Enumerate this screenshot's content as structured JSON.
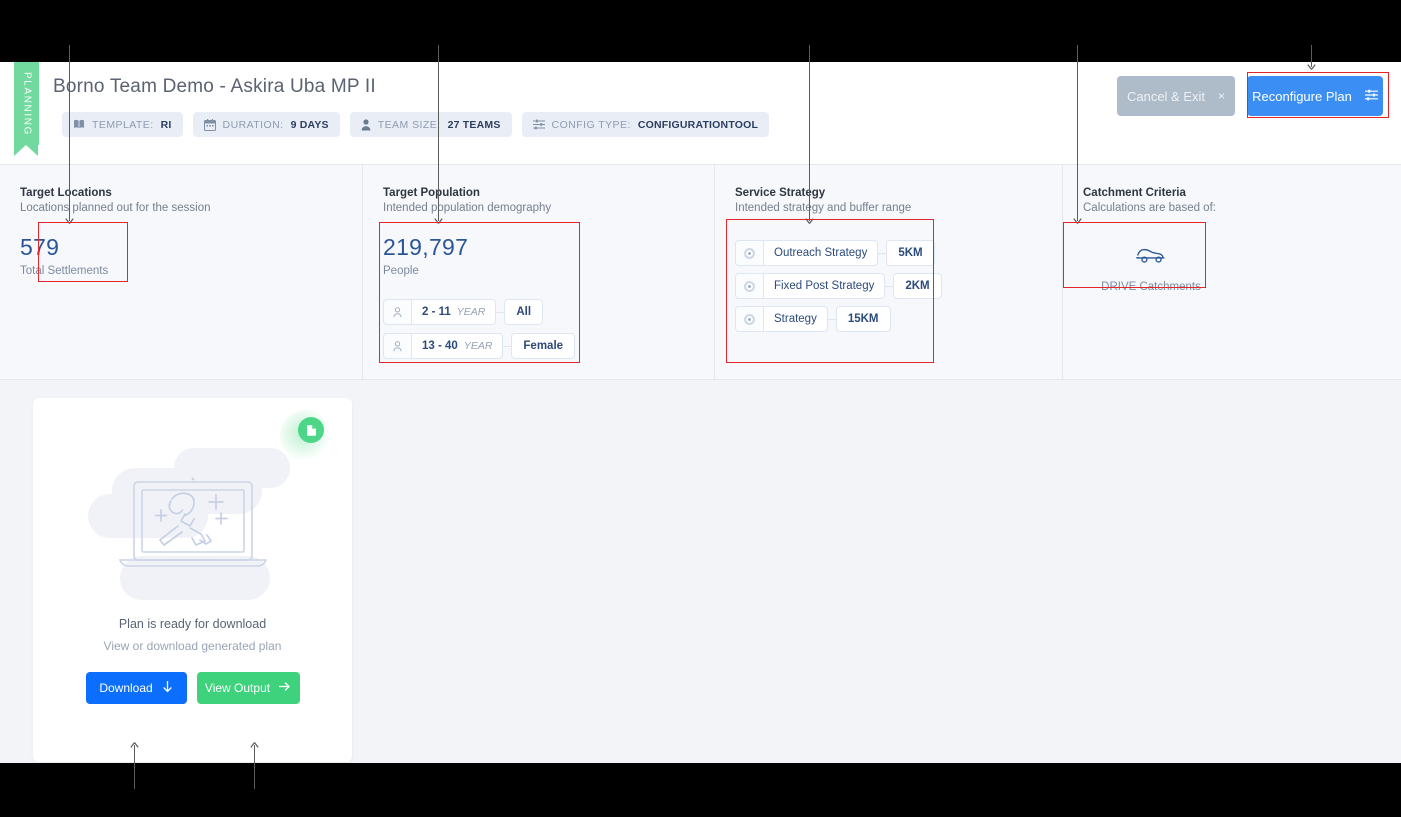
{
  "header": {
    "status_ribbon": "PLANNING",
    "plan_title": "Borno Team Demo - Askira Uba MP II",
    "chips": [
      {
        "icon": "book-icon",
        "label": "TEMPLATE:",
        "value": "RI"
      },
      {
        "icon": "calendar-icon",
        "label": "DURATION:",
        "value": "9 Days"
      },
      {
        "icon": "person-icon",
        "label": "TEAM SIZE:",
        "value": "27 Teams"
      },
      {
        "icon": "sliders-icon",
        "label": "CONFIG TYPE:",
        "value": "CONFIGURATIONTOOL"
      }
    ],
    "cancel_button": "Cancel & Exit",
    "cancel_close_glyph": "×",
    "reconfigure_button": "Reconfigure Plan"
  },
  "summary": {
    "target_locations": {
      "title": "Target Locations",
      "subtitle": "Locations planned out for the session",
      "value": "579",
      "value_label": "Total Settlements"
    },
    "target_population": {
      "title": "Target Population",
      "subtitle": "Intended population demography",
      "value": "219,797",
      "value_label": "People",
      "groups": [
        {
          "icon": "person-icon",
          "range": "2 - 11",
          "unit": "YEAR",
          "gender": "All"
        },
        {
          "icon": "person-icon",
          "range": "13 - 40",
          "unit": "YEAR",
          "gender": "Female"
        }
      ]
    },
    "service_strategy": {
      "title": "Service Strategy",
      "subtitle": "Intended strategy and buffer range",
      "strategies": [
        {
          "icon": "radio-icon",
          "name": "Outreach Strategy",
          "buffer": "5KM"
        },
        {
          "icon": "radio-icon",
          "name": "Fixed Post Strategy",
          "buffer": "2KM"
        },
        {
          "icon": "radio-icon",
          "name": "Strategy",
          "buffer": "15KM"
        }
      ]
    },
    "catchment_criteria": {
      "title": "Catchment Criteria",
      "subtitle": "Calculations are based of:",
      "icon": "car-icon",
      "label": "DRIVE Catchments"
    }
  },
  "download_card": {
    "badge_icon": "document-icon",
    "illustration": "laptop-trophy-illustration",
    "title": "Plan is ready for download",
    "subtitle": "View or download generated plan",
    "download_button": "Download",
    "download_icon": "arrow-down-icon",
    "view_button": "View Output",
    "view_icon": "arrow-right-icon"
  },
  "colors": {
    "accent_blue": "#3b8ef3",
    "download_blue": "#0b6efd",
    "success_green": "#3fd27c",
    "ribbon_green": "#71d99e",
    "cancel_gray": "#aebbc9",
    "metric_blue": "#2a5699",
    "highlight_red": "#e4252a",
    "page_background": "#f2f4f8"
  }
}
